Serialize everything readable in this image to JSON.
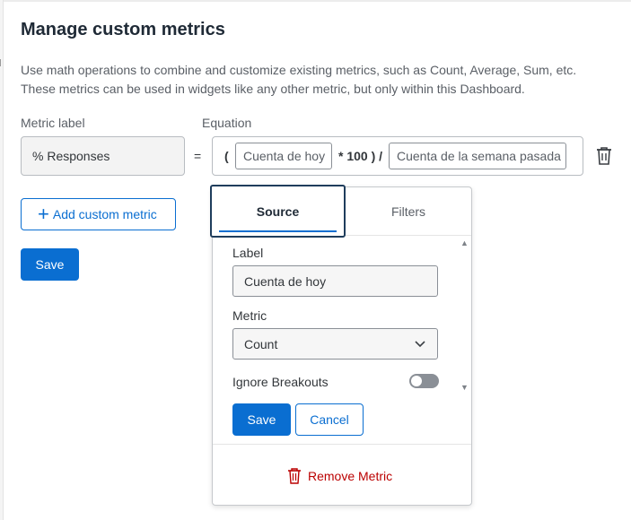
{
  "header": {
    "title": "Manage custom metrics",
    "description_line1": "Use math operations to combine and customize existing metrics, such as Count, Average, Sum, etc.",
    "description_line2": "These metrics can be used in widgets like any other metric, but only within this Dashboard."
  },
  "form": {
    "metric_label_heading": "Metric label",
    "equation_heading": "Equation",
    "metric_label_value": "% Responses",
    "equals": "=",
    "add_button": "Add custom metric",
    "save_button": "Save"
  },
  "equation": {
    "open_paren": "(",
    "token1": "Cuenta de hoy",
    "operator": "* 100 ) /",
    "token2": "Cuenta de la semana pasada"
  },
  "popover": {
    "tabs": [
      "Source",
      "Filters"
    ],
    "active_tab": "Source",
    "label_heading": "Label",
    "label_value": "Cuenta de hoy",
    "metric_heading": "Metric",
    "metric_value": "Count",
    "ignore_breakouts_label": "Ignore Breakouts",
    "ignore_breakouts_on": false,
    "save_button": "Save",
    "cancel_button": "Cancel",
    "remove_button": "Remove Metric"
  },
  "colors": {
    "primary": "#0a6ed1",
    "danger": "#bb0000",
    "title": "#1f2a36"
  },
  "icons": [
    "trash-icon",
    "plus-icon",
    "chevron-down-icon",
    "scroll-up-icon",
    "scroll-down-icon"
  ]
}
